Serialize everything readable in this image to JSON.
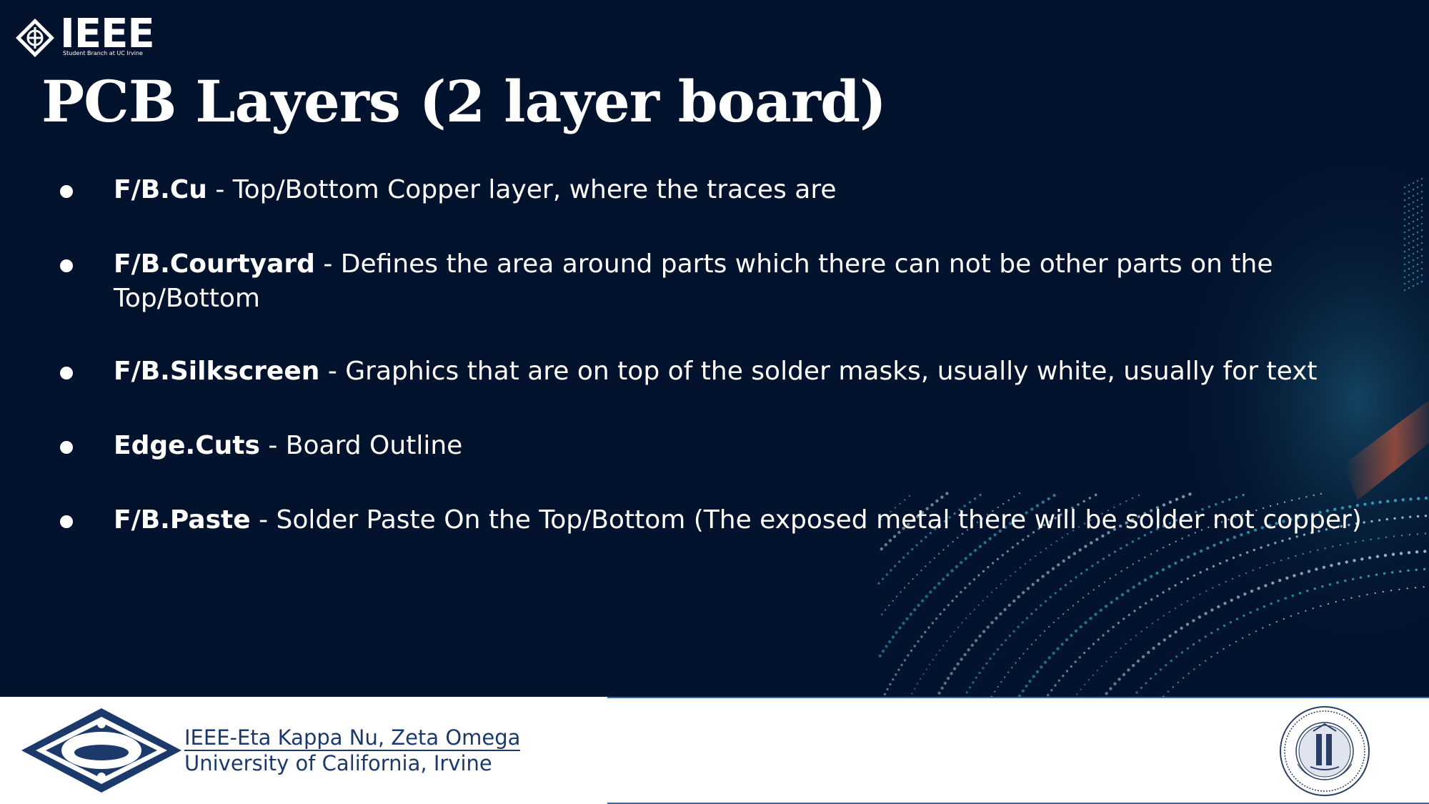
{
  "header": {
    "logo_word": "IEEE",
    "logo_subtitle": "Student Branch at UC Irvine"
  },
  "slide": {
    "title": "PCB Layers (2 layer board)",
    "bullets": [
      {
        "term": "F/B.Cu",
        "text": " - Top/Bottom Copper layer, where the traces are"
      },
      {
        "term": "F/B.Courtyard",
        "text": " - Defines the area around parts which there can not be other parts on the Top/Bottom"
      },
      {
        "term": "F/B.Silkscreen",
        "text": " - Graphics that are on top of the solder masks, usually white, usually for text"
      },
      {
        "term": "Edge.Cuts",
        "text": " - Board Outline"
      },
      {
        "term": "F/B.Paste",
        "text": " - Solder Paste On the Top/Bottom (The exposed metal there will be solder not copper)"
      }
    ]
  },
  "footer": {
    "org_line1": "IEEE-Eta Kappa Nu, Zeta Omega",
    "org_line2": "University of California, Irvine"
  },
  "colors": {
    "background": "#03132d",
    "text": "#ffffff",
    "footer_text": "#1b3a6b",
    "accent_teal": "#3fb6d6"
  },
  "icons": {
    "top_logo": "ieee-diamond-icon",
    "footer_logo": "hkn-diamond-icon",
    "seal": "uc-seal-icon"
  }
}
